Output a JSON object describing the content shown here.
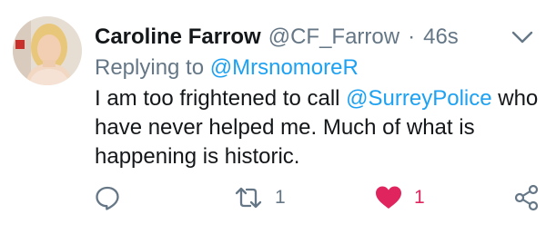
{
  "author": {
    "display_name": "Caroline Farrow",
    "handle": "@CF_Farrow",
    "separator": "·",
    "time": "46s"
  },
  "reply": {
    "prefix": "Replying to",
    "mention": "@MrsnomoreR"
  },
  "tweet": {
    "line1_before": "I am too frightened to call ",
    "line1_mention": "@SurreyPolice",
    "line1_after": " who",
    "line2": "have never helped me. Much of what is",
    "line3": "happening is historic."
  },
  "actions": {
    "retweet_count": "1",
    "like_count": "1"
  },
  "icons": {
    "menu": "chevron-down-icon",
    "reply": "comment-icon",
    "retweet": "retweet-icon",
    "like": "heart-filled-icon",
    "share": "share-icon"
  },
  "colors": {
    "link": "#1da1f2",
    "secondary_text": "#657786",
    "like": "#e0245e",
    "primary_text": "#14171a"
  }
}
